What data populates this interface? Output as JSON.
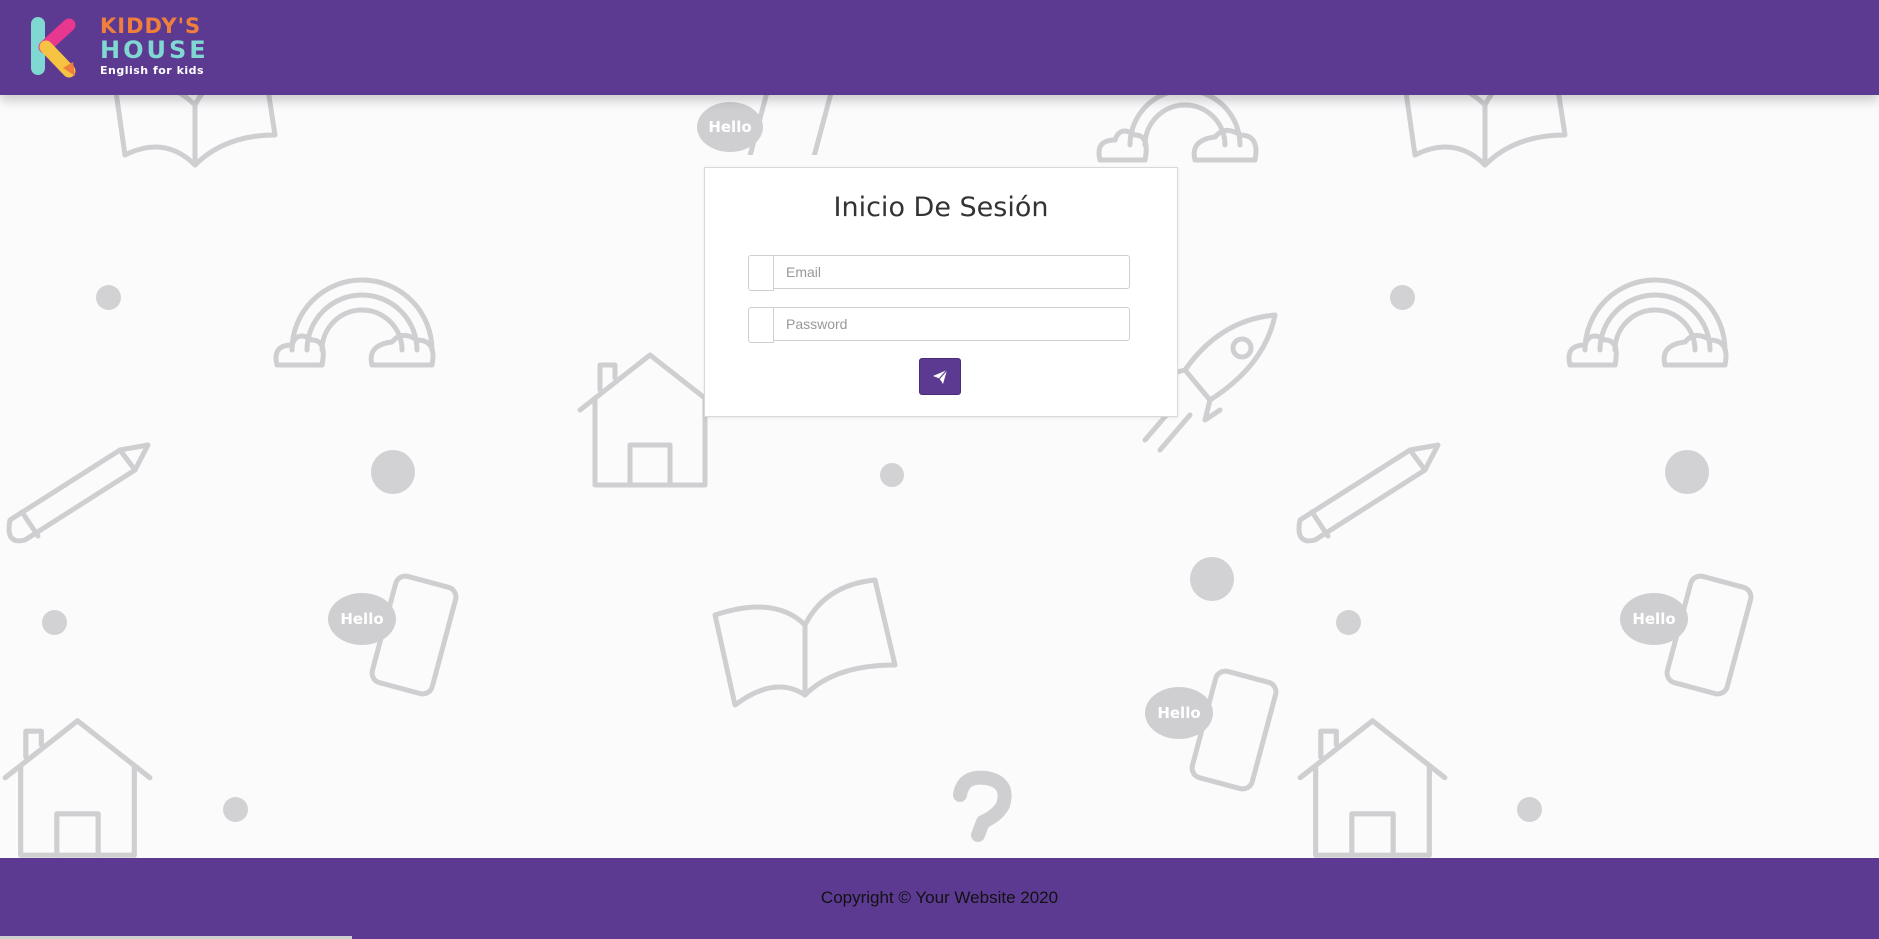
{
  "header": {
    "logo": {
      "line1": "KIDDY'S",
      "line2": "HOUSE",
      "tagline": "English for kids",
      "colors": {
        "orange": "#f07f3c",
        "teal": "#7fd8d1",
        "pink": "#e8378f",
        "yellow": "#f6c343"
      }
    },
    "background_color": "#5c3a92"
  },
  "login": {
    "title": "Inicio De Sesión",
    "email_placeholder": "Email",
    "password_placeholder": "Password",
    "submit_icon": "paper-plane-icon",
    "accent": "#5c3a92"
  },
  "background": {
    "speech_bubble_text": "Hello"
  },
  "footer": {
    "copyright": "Copyright © Your Website 2020"
  }
}
